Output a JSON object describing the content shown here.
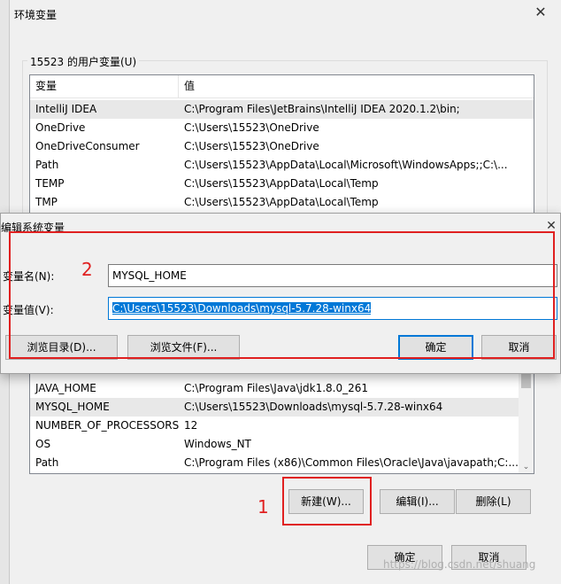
{
  "outer_window": {
    "title": "环境变量",
    "user_group_label": "15523 的用户变量(U)",
    "user_table": {
      "headers": [
        "变量",
        "值"
      ],
      "rows": [
        {
          "name": "IntelliJ IDEA",
          "value": "C:\\Program Files\\JetBrains\\IntelliJ IDEA 2020.1.2\\bin;"
        },
        {
          "name": "OneDrive",
          "value": "C:\\Users\\15523\\OneDrive"
        },
        {
          "name": "OneDriveConsumer",
          "value": "C:\\Users\\15523\\OneDrive"
        },
        {
          "name": "Path",
          "value": "C:\\Users\\15523\\AppData\\Local\\Microsoft\\WindowsApps;;C:\\..."
        },
        {
          "name": "TEMP",
          "value": "C:\\Users\\15523\\AppData\\Local\\Temp"
        },
        {
          "name": "TMP",
          "value": "C:\\Users\\15523\\AppData\\Local\\Temp"
        }
      ]
    },
    "system_table": {
      "rows": [
        {
          "name": "JAVA_HOME",
          "value": "C:\\Program Files\\Java\\jdk1.8.0_261"
        },
        {
          "name": "MYSQL_HOME",
          "value": "C:\\Users\\15523\\Downloads\\mysql-5.7.28-winx64"
        },
        {
          "name": "NUMBER_OF_PROCESSORS",
          "value": "12"
        },
        {
          "name": "OS",
          "value": "Windows_NT"
        },
        {
          "name": "Path",
          "value": "C:\\Program Files (x86)\\Common Files\\Oracle\\Java\\javapath;C:..."
        }
      ]
    },
    "buttons": {
      "new": "新建(W)...",
      "edit": "编辑(I)...",
      "delete": "删除(L)",
      "ok": "确定",
      "cancel": "取消"
    },
    "annotation_1": "1"
  },
  "edit_dialog": {
    "title": "编辑系统变量",
    "name_label": "变量名(N):",
    "value_label": "变量值(V):",
    "name_value": "MYSQL_HOME",
    "value_value": "C:\\Users\\15523\\Downloads\\mysql-5.7.28-winx64",
    "browse_dir": "浏览目录(D)...",
    "browse_file": "浏览文件(F)...",
    "ok": "确定",
    "cancel": "取消",
    "annotation_2": "2"
  },
  "watermark": "https://blog.csdn.net/shuang",
  "colors": {
    "annotation": "#e02020",
    "selection": "#0078d7",
    "accent_border": "#0078d7"
  }
}
